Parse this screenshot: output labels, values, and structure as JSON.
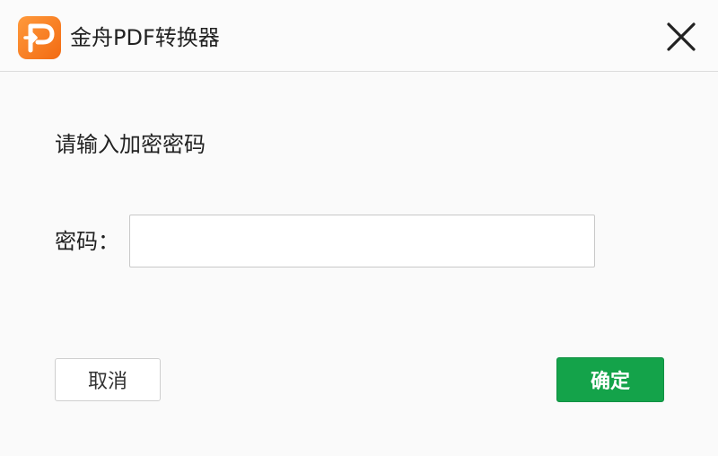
{
  "window": {
    "title": "金舟PDF转换器",
    "logo_icon": "app-logo-icon",
    "close_icon": "close-icon"
  },
  "dialog": {
    "prompt": "请输入加密密码",
    "password_label": "密码：",
    "password_value": "",
    "password_placeholder": ""
  },
  "buttons": {
    "cancel_label": "取消",
    "ok_label": "确定"
  },
  "colors": {
    "brand_orange": "#f57c21",
    "ok_green": "#14a34a"
  }
}
